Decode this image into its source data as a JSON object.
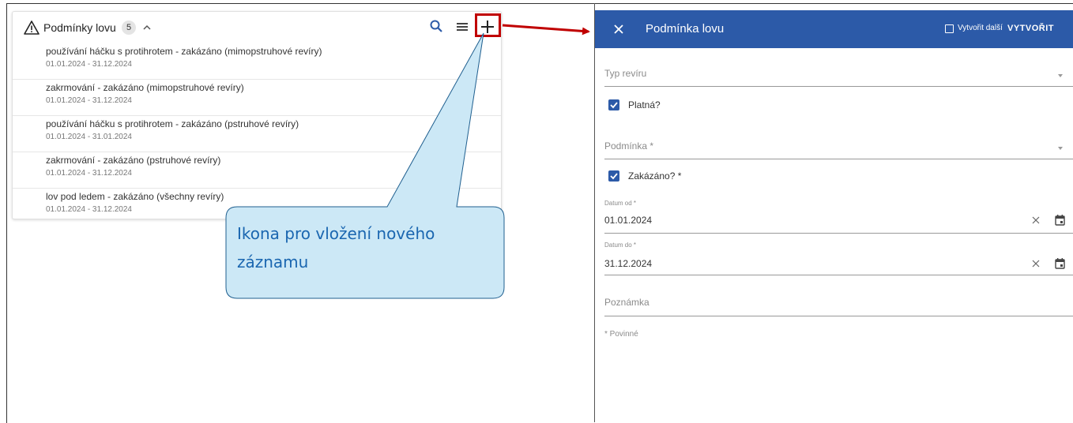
{
  "colors": {
    "accent": "#2c5aa8",
    "highlight": "#c00000",
    "callout_fill": "#cce8f6",
    "callout_text": "#1a66b0"
  },
  "left_card": {
    "title": "Podmínky lovu",
    "count": "5",
    "icons": [
      "warning-icon",
      "chevron-up-icon",
      "search-icon",
      "menu-icon",
      "add-icon"
    ],
    "items": [
      {
        "title": "používání háčku s protihrotem - zakázáno (mimopstruhové revíry)",
        "dates": "01.01.2024 - 31.12.2024"
      },
      {
        "title": "zakrmování - zakázáno (mimopstruhové revíry)",
        "dates": "01.01.2024 - 31.12.2024"
      },
      {
        "title": "používání háčku s protihrotem - zakázáno (pstruhové revíry)",
        "dates": "01.01.2024 - 31.01.2024"
      },
      {
        "title": "zakrmování - zakázáno (pstruhové revíry)",
        "dates": "01.01.2024 - 31.12.2024"
      },
      {
        "title": "lov pod ledem - zakázáno (všechny revíry)",
        "dates": "01.01.2024 - 31.12.2024"
      }
    ]
  },
  "callout": {
    "line1": "Ikona pro vložení nového",
    "line2": "záznamu"
  },
  "panel": {
    "title": "Podmínka lovu",
    "create_another_label": "Vytvořit další",
    "create_another_checked": false,
    "create_button": "VYTVOŘIT",
    "fields": {
      "typ_reviru_label": "Typ revíru",
      "platna_label": "Platná?",
      "platna_checked": true,
      "podminka_label": "Podmínka *",
      "zakazano_label": "Zakázáno? *",
      "zakazano_checked": true,
      "datum_od_label": "Datum od *",
      "datum_od_value": "01.01.2024",
      "datum_do_label": "Datum do *",
      "datum_do_value": "31.12.2024",
      "poznamka_label": "Poznámka"
    },
    "required_note": "* Povinné"
  }
}
